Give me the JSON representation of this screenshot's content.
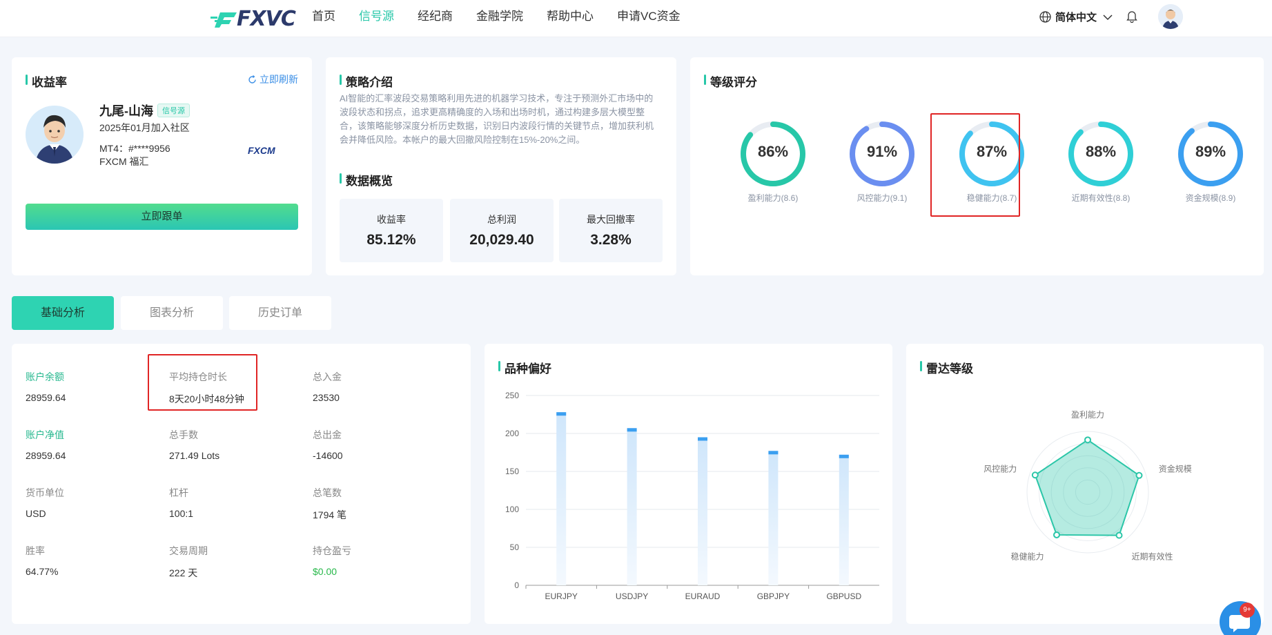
{
  "header": {
    "logo": "FXVC",
    "nav": [
      "首页",
      "信号源",
      "经纪商",
      "金融学院",
      "帮助中心",
      "申请VC资金"
    ],
    "active_nav": 1,
    "language": "简体中文"
  },
  "profile": {
    "title": "收益率",
    "refresh": "立即刷新",
    "name": "九尾-山海",
    "tag": "信号源",
    "joined": "2025年01月加入社区",
    "mt4": "MT4：#****9956",
    "broker": "FXCM 福汇",
    "broker_logo": "FXCM",
    "follow_button": "立即跟单"
  },
  "strategy": {
    "title": "策略介绍",
    "description": "AI智能的汇率波段交易策略利用先进的机器学习技术，专注于预测外汇市场中的波段状态和拐点，追求更高精确度的入场和出场时机，通过构建多层大模型整合，该策略能够深度分析历史数据，识别日内波段行情的关键节点，增加获利机会并降低风险。本帐户的最大回撤风险控制在15%-20%之间。",
    "overview_title": "数据概览",
    "stats": [
      {
        "label": "收益率",
        "value": "85.12%"
      },
      {
        "label": "总利润",
        "value": "20,029.40"
      },
      {
        "label": "最大回撤率",
        "value": "3.28%"
      }
    ]
  },
  "rating": {
    "title": "等级评分",
    "gauges": [
      {
        "value": "86%",
        "percent": 86,
        "label": "盈利能力(8.6)",
        "color": "#27c7a8"
      },
      {
        "value": "91%",
        "percent": 91,
        "label": "风控能力(9.1)",
        "color": "#6a8ef0"
      },
      {
        "value": "87%",
        "percent": 87,
        "label": "稳健能力(8.7)",
        "color": "#3fc3f0"
      },
      {
        "value": "88%",
        "percent": 88,
        "label": "近期有效性(8.8)",
        "color": "#2fcfd6"
      },
      {
        "value": "89%",
        "percent": 89,
        "label": "资金规模(8.9)",
        "color": "#3b9ff0"
      }
    ]
  },
  "tabs": [
    "基础分析",
    "图表分析",
    "历史订单"
  ],
  "basic": {
    "items": [
      {
        "label": "账户余额",
        "value": "28959.64",
        "green_label": true
      },
      {
        "label": "平均持仓时长",
        "value": "8天20小时48分钟"
      },
      {
        "label": "总入金",
        "value": "23530"
      },
      {
        "label": "账户净值",
        "value": "28959.64",
        "green_label": true
      },
      {
        "label": "总手数",
        "value": "271.49 Lots"
      },
      {
        "label": "总出金",
        "value": "-14600"
      },
      {
        "label": "货币单位",
        "value": "USD"
      },
      {
        "label": "杠杆",
        "value": "100:1"
      },
      {
        "label": "总笔数",
        "value": "1794 笔"
      },
      {
        "label": "胜率",
        "value": "64.77%"
      },
      {
        "label": "交易周期",
        "value": "222 天"
      },
      {
        "label": "持仓盈亏",
        "value": "$0.00",
        "green_value": true
      }
    ]
  },
  "variety": {
    "title": "品种偏好"
  },
  "radar": {
    "title": "雷达等级"
  },
  "chart_data": [
    {
      "type": "bar",
      "title": "品种偏好",
      "categories": [
        "EURJPY",
        "USDJPY",
        "EURAUD",
        "GBPJPY",
        "GBPUSD"
      ],
      "values": [
        228,
        207,
        195,
        177,
        172
      ],
      "ylim": [
        0,
        250
      ],
      "yticks": [
        0,
        50,
        100,
        150,
        200,
        250
      ],
      "grid": true,
      "color": "#3b9ff0"
    },
    {
      "type": "radar",
      "title": "雷达等级",
      "categories": [
        "盈利能力",
        "资金规模",
        "近期有效性",
        "稳健能力",
        "风控能力"
      ],
      "values": [
        8.6,
        8.9,
        8.8,
        8.7,
        9.1
      ],
      "max": 10,
      "color": "#2bc6a8"
    }
  ],
  "chat": {
    "badge": "9+"
  }
}
